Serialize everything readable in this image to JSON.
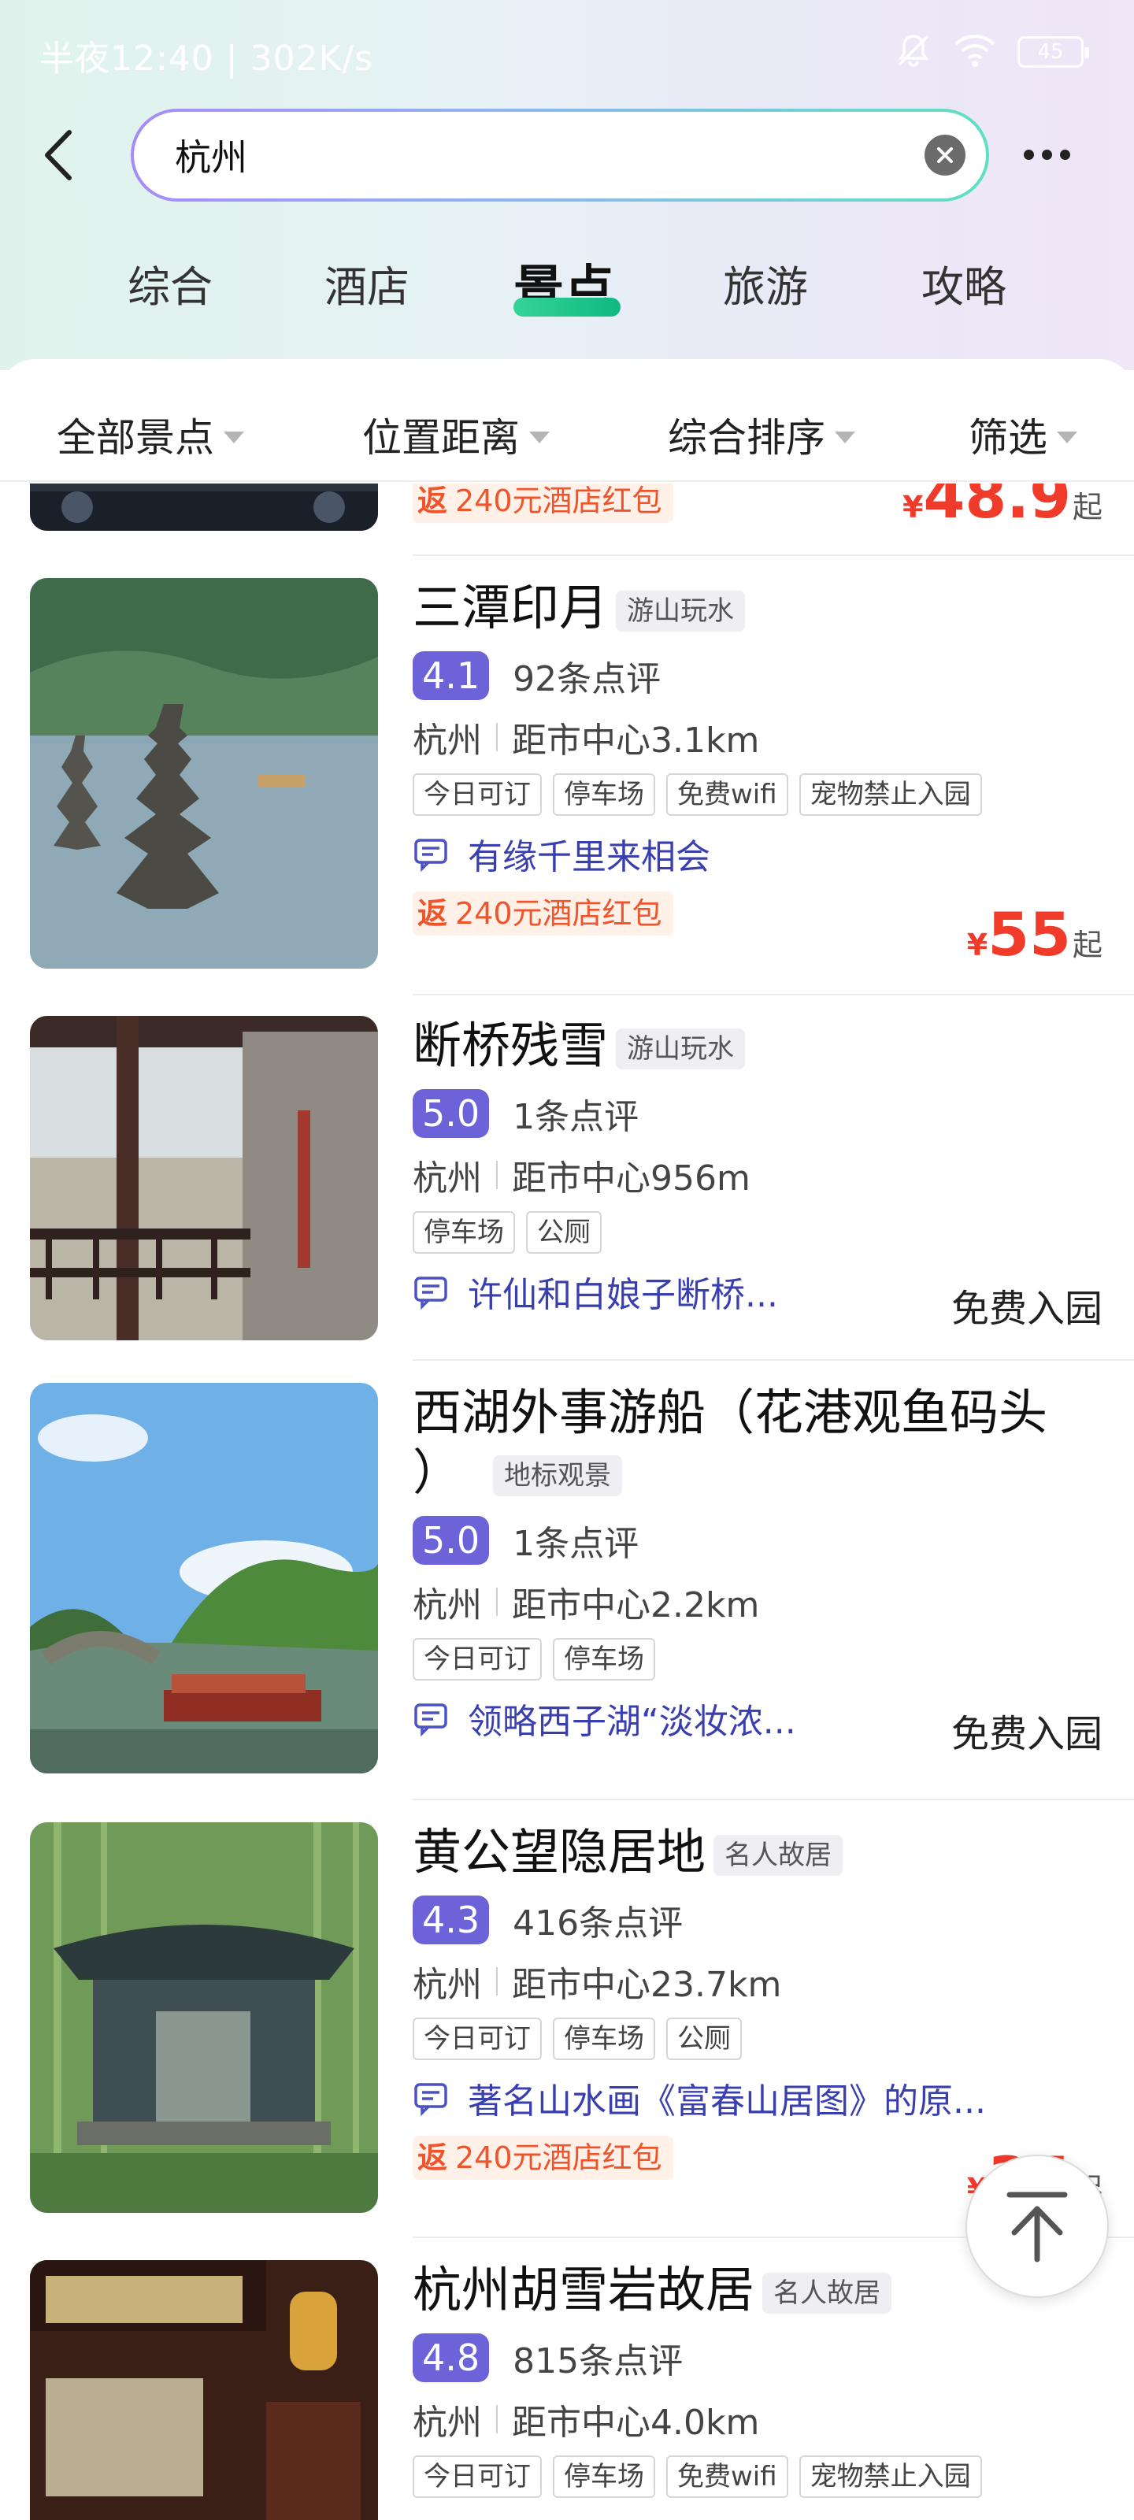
{
  "status_bar": {
    "text": "半夜12:40 | 302K/s",
    "battery": "45"
  },
  "search": {
    "query": "杭州"
  },
  "tabs": [
    {
      "label": "综合"
    },
    {
      "label": "酒店"
    },
    {
      "label": "景点",
      "active": true
    },
    {
      "label": "旅游"
    },
    {
      "label": "攻略"
    }
  ],
  "filters": [
    {
      "label": "全部景点"
    },
    {
      "label": "位置距离"
    },
    {
      "label": "综合排序"
    },
    {
      "label": "筛选"
    }
  ],
  "partial_item": {
    "promo": "240元酒店红包",
    "promo_prefix": "返",
    "price_currency": "¥",
    "price": "48.9",
    "price_suffix": "起"
  },
  "items": [
    {
      "title": "三潭印月",
      "category": "游山玩水",
      "rating": "4.1",
      "reviews": "92条点评",
      "city": "杭州",
      "distance": "距市中心3.1km",
      "tags": [
        "今日可订",
        "停车场",
        "免费wifi",
        "宠物禁止入园"
      ],
      "quote": "有缘千里来相会",
      "promo_prefix": "返",
      "promo": "240元酒店红包",
      "price_currency": "¥",
      "price": "55",
      "price_suffix": "起"
    },
    {
      "title": "断桥残雪",
      "category": "游山玩水",
      "rating": "5.0",
      "reviews": "1条点评",
      "city": "杭州",
      "distance": "距市中心956m",
      "tags": [
        "停车场",
        "公厕"
      ],
      "quote": "许仙和白娘子断桥...",
      "free": "免费入园"
    },
    {
      "title": "西湖外事游船（花港观鱼码头）",
      "title_line1": "西湖外事游船（花港观鱼码头",
      "title_line2": "）",
      "category": "地标观景",
      "rating": "5.0",
      "reviews": "1条点评",
      "city": "杭州",
      "distance": "距市中心2.2km",
      "tags": [
        "今日可订",
        "停车场"
      ],
      "quote": "领略西子湖“淡妆浓...",
      "free": "免费入园"
    },
    {
      "title": "黄公望隐居地",
      "category": "名人故居",
      "rating": "4.3",
      "reviews": "416条点评",
      "city": "杭州",
      "distance": "距市中心23.7km",
      "tags": [
        "今日可订",
        "停车场",
        "公厕"
      ],
      "quote": "著名山水画《富春山居图》的原...",
      "promo_prefix": "返",
      "promo": "240元酒店红包",
      "price_currency": "¥",
      "price": "35",
      "price_suffix": "起"
    },
    {
      "title": "杭州胡雪岩故居",
      "category": "名人故居",
      "rating": "4.8",
      "reviews": "815条点评",
      "city": "杭州",
      "distance": "距市中心4.0km",
      "tags": [
        "今日可订",
        "停车场",
        "免费wifi",
        "宠物禁止入园"
      ]
    }
  ]
}
